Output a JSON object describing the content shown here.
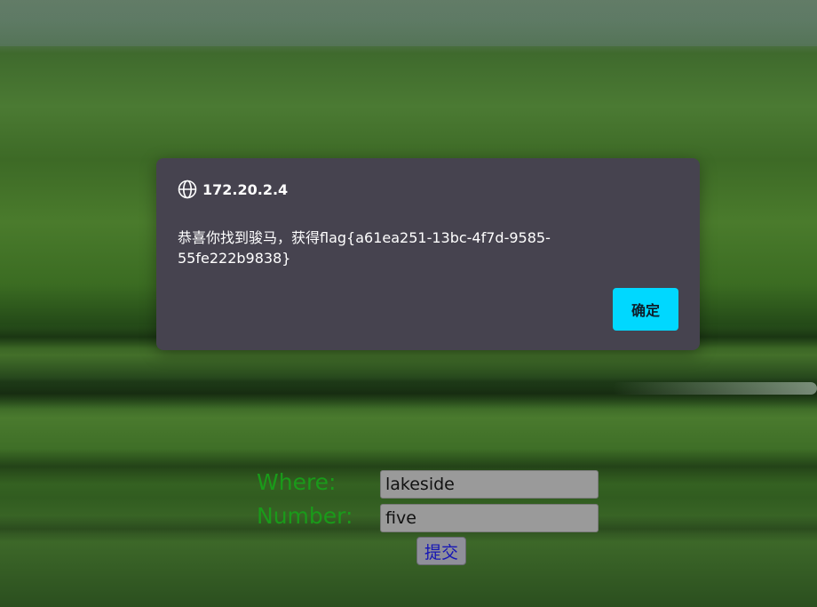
{
  "dialog": {
    "origin": "172.20.2.4",
    "message": "恭喜你找到骏马，获得flag{a61ea251-13bc-4f7d-9585-55fe222b9838}",
    "ok_label": "确定",
    "icon": "globe-icon"
  },
  "form": {
    "where_label": "Where:",
    "where_value": "lakeside",
    "number_label": "Number:",
    "number_value": "five",
    "submit_label": "提交"
  },
  "colors": {
    "dialog_bg": "#46434f",
    "ok_button_bg": "#00d8ff",
    "label_color": "#1a9a1a",
    "submit_text": "#1515b5"
  }
}
